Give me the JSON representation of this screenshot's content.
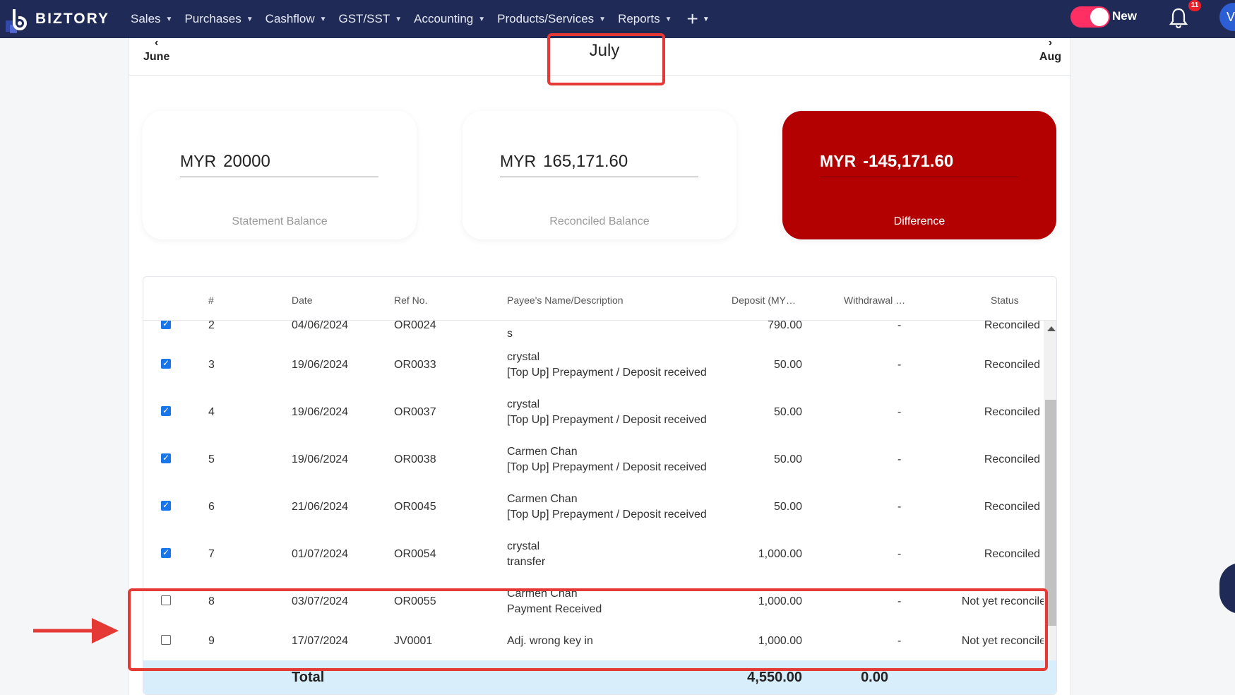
{
  "nav": {
    "brand": "BIZTORY",
    "menu": [
      "Sales",
      "Purchases",
      "Cashflow",
      "GST/SST",
      "Accounting",
      "Products/Services",
      "Reports"
    ],
    "plus_label": "+",
    "toggle_label": "New",
    "notifications_count": "11",
    "avatar_initial": "V"
  },
  "period": {
    "prev_label": "June",
    "current": "July",
    "next_label": "Aug"
  },
  "cards": [
    {
      "currency": "MYR",
      "value": "20000",
      "caption": "Statement Balance"
    },
    {
      "currency": "MYR",
      "value": "165,171.60",
      "caption": "Reconciled Balance"
    },
    {
      "currency": "MYR",
      "value": "-145,171.60",
      "caption": "Difference"
    }
  ],
  "table": {
    "headers": {
      "num": "#",
      "date": "Date",
      "ref": "Ref No.",
      "payee": "Payee's Name/Description",
      "deposit": "Deposit (MY…",
      "withdrawal": "Withdrawal …",
      "status": "Status"
    },
    "rows": [
      {
        "checked": true,
        "num": "2",
        "date": "04/06/2024",
        "ref": "OR0024",
        "payee1": "",
        "payee2": "s",
        "deposit": "790.00",
        "withdrawal": "-",
        "status": "Reconciled"
      },
      {
        "checked": true,
        "num": "3",
        "date": "19/06/2024",
        "ref": "OR0033",
        "payee1": "crystal",
        "payee2": "[Top Up] Prepayment / Deposit received",
        "deposit": "50.00",
        "withdrawal": "-",
        "status": "Reconciled"
      },
      {
        "checked": true,
        "num": "4",
        "date": "19/06/2024",
        "ref": "OR0037",
        "payee1": "crystal",
        "payee2": "[Top Up] Prepayment / Deposit received",
        "deposit": "50.00",
        "withdrawal": "-",
        "status": "Reconciled"
      },
      {
        "checked": true,
        "num": "5",
        "date": "19/06/2024",
        "ref": "OR0038",
        "payee1": "Carmen Chan",
        "payee2": "[Top Up] Prepayment / Deposit received",
        "deposit": "50.00",
        "withdrawal": "-",
        "status": "Reconciled"
      },
      {
        "checked": true,
        "num": "6",
        "date": "21/06/2024",
        "ref": "OR0045",
        "payee1": "Carmen Chan",
        "payee2": "[Top Up] Prepayment / Deposit received",
        "deposit": "50.00",
        "withdrawal": "-",
        "status": "Reconciled"
      },
      {
        "checked": true,
        "num": "7",
        "date": "01/07/2024",
        "ref": "OR0054",
        "payee1": "crystal",
        "payee2": "transfer",
        "deposit": "1,000.00",
        "withdrawal": "-",
        "status": "Reconciled"
      },
      {
        "checked": false,
        "num": "8",
        "date": "03/07/2024",
        "ref": "OR0055",
        "payee1": "Carmen Chan",
        "payee2": "Payment Received",
        "deposit": "1,000.00",
        "withdrawal": "-",
        "status": "Not yet reconcile"
      },
      {
        "checked": false,
        "num": "9",
        "date": "17/07/2024",
        "ref": "JV0001",
        "payee1": "Adj. wrong key in",
        "payee2": "",
        "deposit": "1,000.00",
        "withdrawal": "-",
        "status": "Not yet reconcile"
      }
    ],
    "total": {
      "label": "Total",
      "deposit": "4,550.00",
      "withdrawal": "0.00"
    }
  },
  "colors": {
    "nav_bg": "#1f2a56",
    "toggle_on": "#ff2e63",
    "difference_card": "#b30000",
    "reconciled": "#43a047",
    "link": "#1560b8",
    "checkbox": "#1976e8",
    "annotation": "#e53935",
    "total_bg": "#d9eefb"
  }
}
